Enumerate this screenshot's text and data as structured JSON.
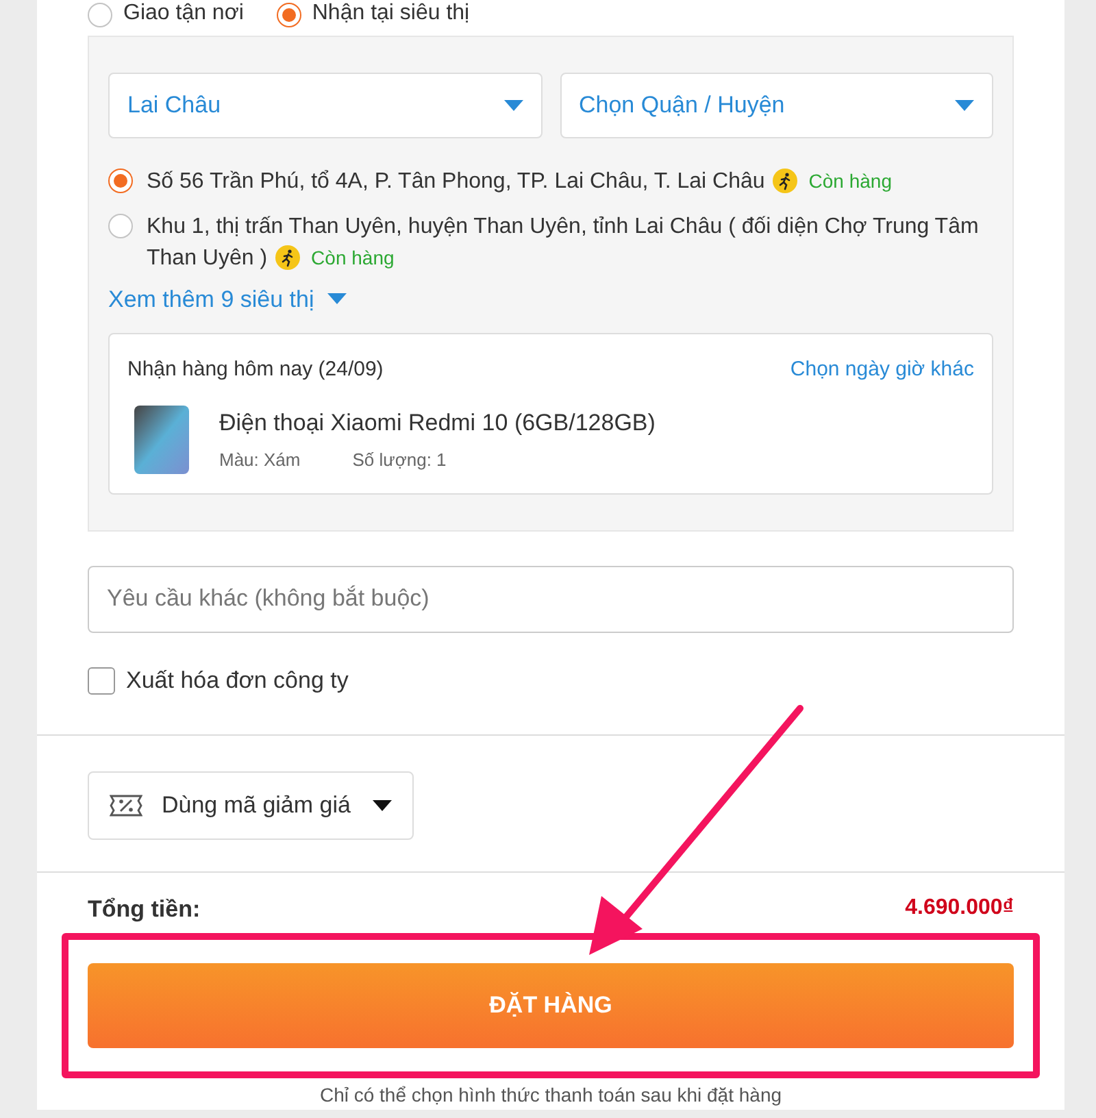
{
  "delivery_options": [
    {
      "label": "Giao tận nơi",
      "selected": false
    },
    {
      "label": "Nhận tại siêu thị",
      "selected": true
    }
  ],
  "province_select": {
    "value": "Lai Châu"
  },
  "district_select": {
    "placeholder": "Chọn Quận / Huyện"
  },
  "stores": [
    {
      "address": "Số 56 Trần Phú, tổ 4A, P. Tân Phong, TP. Lai Châu, T. Lai Châu",
      "stock": "Còn hàng",
      "selected": true
    },
    {
      "address": "Khu 1, thị trấn Than Uyên, huyện Than Uyên, tỉnh Lai Châu ( đối diện Chợ Trung Tâm Than Uyên )",
      "stock": "Còn hàng",
      "selected": false
    }
  ],
  "see_more": "Xem thêm 9 siêu thị",
  "pickup": {
    "title": "Nhận hàng hôm nay (24/09)",
    "change_link": "Chọn ngày giờ khác",
    "product": {
      "name": "Điện thoại Xiaomi Redmi 10 (6GB/128GB)",
      "color_text": "Màu: Xám",
      "quantity": "Số lượng: 1"
    }
  },
  "note_field": {
    "placeholder": "Yêu cầu khác (không bắt buộc)"
  },
  "invoice": {
    "label": "Xuất hóa đơn công ty",
    "checked": false
  },
  "coupon": {
    "label": "Dùng mã giảm giá"
  },
  "total": {
    "label": "Tổng tiền:",
    "value": "4.690.000₫"
  },
  "order_button": "ĐẶT HÀNG",
  "footer_note": "Chỉ có thể chọn hình thức thanh toán sau khi đặt hàng"
}
